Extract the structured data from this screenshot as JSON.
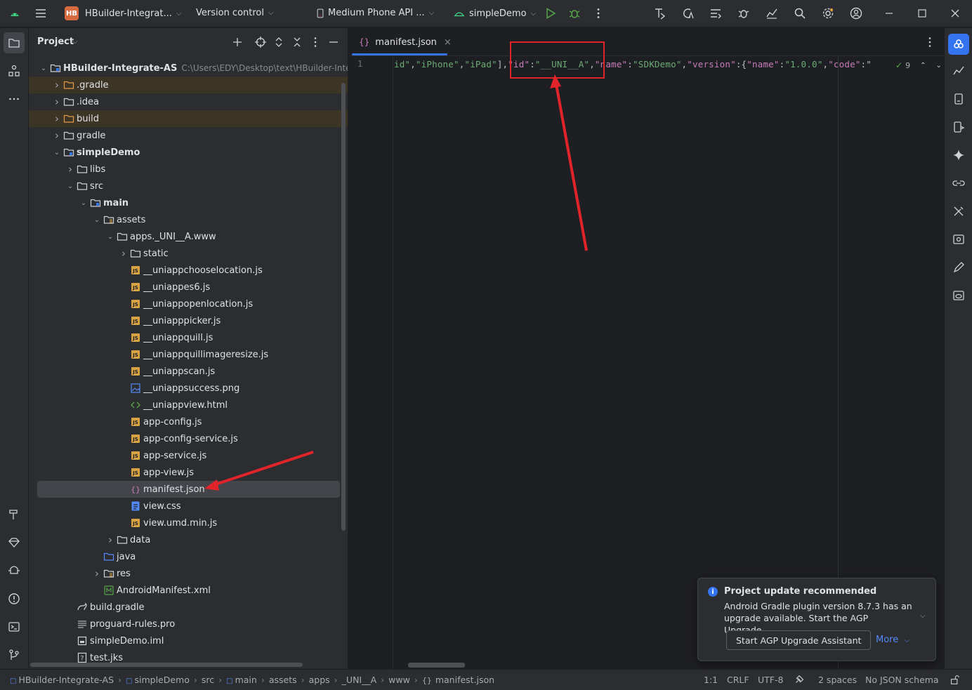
{
  "titlebar": {
    "project_badge": "HB",
    "project_name": "HBuilder-Integrat...",
    "vcs": "Version control",
    "device": "Medium Phone API ...",
    "run_config": "simpleDemo"
  },
  "project_panel": {
    "title": "Project",
    "tree": [
      {
        "label": "HBuilder-Integrate-AS",
        "path": "C:\\Users\\EDY\\Desktop\\text\\HBuilder-Integra",
        "icon": "module-folder-icon",
        "arrow": "down",
        "bold": true
      },
      {
        "label": ".gradle",
        "icon": "folder-orange-icon",
        "arrow": "right"
      },
      {
        "label": ".idea",
        "icon": "folder-icon",
        "arrow": "right"
      },
      {
        "label": "build",
        "icon": "folder-orange-icon",
        "arrow": "right"
      },
      {
        "label": "gradle",
        "icon": "folder-icon",
        "arrow": "right"
      },
      {
        "label": "simpleDemo",
        "icon": "module-folder-icon",
        "arrow": "down",
        "bold": true
      },
      {
        "label": "libs",
        "icon": "folder-icon",
        "arrow": "right"
      },
      {
        "label": "src",
        "icon": "folder-icon",
        "arrow": "down"
      },
      {
        "label": "main",
        "icon": "module-folder-icon",
        "arrow": "down",
        "bold": true
      },
      {
        "label": "assets",
        "icon": "resource-folder-icon",
        "arrow": "down"
      },
      {
        "label": "apps._UNI__A.www",
        "icon": "folder-icon",
        "arrow": "down"
      },
      {
        "label": "static",
        "icon": "folder-icon",
        "arrow": "right"
      },
      {
        "label": "__uniappchooselocation.js",
        "icon": "js-file-icon"
      },
      {
        "label": "__uniappes6.js",
        "icon": "js-file-icon"
      },
      {
        "label": "__uniappopenlocation.js",
        "icon": "js-file-icon"
      },
      {
        "label": "__uniapppicker.js",
        "icon": "js-file-icon"
      },
      {
        "label": "__uniappquill.js",
        "icon": "js-file-icon"
      },
      {
        "label": "__uniappquillimageresize.js",
        "icon": "js-file-icon"
      },
      {
        "label": "__uniappscan.js",
        "icon": "js-file-icon"
      },
      {
        "label": "__uniappsuccess.png",
        "icon": "image-file-icon"
      },
      {
        "label": "__uniappview.html",
        "icon": "html-file-icon"
      },
      {
        "label": "app-config.js",
        "icon": "js-file-icon"
      },
      {
        "label": "app-config-service.js",
        "icon": "js-file-icon"
      },
      {
        "label": "app-service.js",
        "icon": "js-file-icon"
      },
      {
        "label": "app-view.js",
        "icon": "js-file-icon"
      },
      {
        "label": "manifest.json",
        "icon": "json-file-icon"
      },
      {
        "label": "view.css",
        "icon": "css-file-icon"
      },
      {
        "label": "view.umd.min.js",
        "icon": "js-file-icon"
      },
      {
        "label": "data",
        "icon": "folder-icon",
        "arrow": "right"
      },
      {
        "label": "java",
        "icon": "source-folder-icon"
      },
      {
        "label": "res",
        "icon": "resource-folder-icon",
        "arrow": "right"
      },
      {
        "label": "AndroidManifest.xml",
        "icon": "manifest-file-icon"
      },
      {
        "label": "build.gradle",
        "icon": "gradle-file-icon"
      },
      {
        "label": "proguard-rules.pro",
        "icon": "text-file-icon"
      },
      {
        "label": "simpleDemo.iml",
        "icon": "iml-file-icon"
      },
      {
        "label": "test.jks",
        "icon": "unknown-file-icon"
      }
    ]
  },
  "editor": {
    "tab_label": "manifest.json",
    "line_number": "1",
    "code_tokens": [
      {
        "t": "id\"",
        "c": "str"
      },
      {
        "t": ",",
        "c": "punc"
      },
      {
        "t": "\"iPhone\"",
        "c": "str"
      },
      {
        "t": ",",
        "c": "punc"
      },
      {
        "t": "\"iPad\"",
        "c": "str"
      },
      {
        "t": "],",
        "c": "punc"
      },
      {
        "t": "\"id\"",
        "c": "key"
      },
      {
        "t": ":",
        "c": "punc"
      },
      {
        "t": "\"__UNI__A\"",
        "c": "str"
      },
      {
        "t": ",",
        "c": "punc"
      },
      {
        "t": "\"name\"",
        "c": "key"
      },
      {
        "t": ":",
        "c": "punc"
      },
      {
        "t": "\"SDKDemo\"",
        "c": "str"
      },
      {
        "t": ",",
        "c": "punc"
      },
      {
        "t": "\"version\"",
        "c": "key"
      },
      {
        "t": ":{",
        "c": "punc"
      },
      {
        "t": "\"name\"",
        "c": "key"
      },
      {
        "t": ":",
        "c": "punc"
      },
      {
        "t": "\"1.0.0\"",
        "c": "str"
      },
      {
        "t": ",",
        "c": "punc"
      },
      {
        "t": "\"code\"",
        "c": "key"
      },
      {
        "t": ":\"",
        "c": "punc"
      }
    ],
    "inspection_count": "9"
  },
  "notification": {
    "title": "Project update recommended",
    "body": "Android Gradle plugin version 8.7.3 has an upgrade available. Start the AGP Upgrade...",
    "button": "Start AGP Upgrade Assistant",
    "more": "More"
  },
  "statusbar": {
    "breadcrumbs": [
      "HBuilder-Integrate-AS",
      "simpleDemo",
      "src",
      "main",
      "assets",
      "apps",
      "_UNI__A",
      "www",
      "manifest.json"
    ],
    "position": "1:1",
    "line_sep": "CRLF",
    "encoding": "UTF-8",
    "indent": "2 spaces",
    "schema": "No JSON schema"
  },
  "colors": {
    "annotation": "#e0242a",
    "accent": "#3574f0",
    "json_string": "#6aab73",
    "json_key": "#c77dbb"
  }
}
